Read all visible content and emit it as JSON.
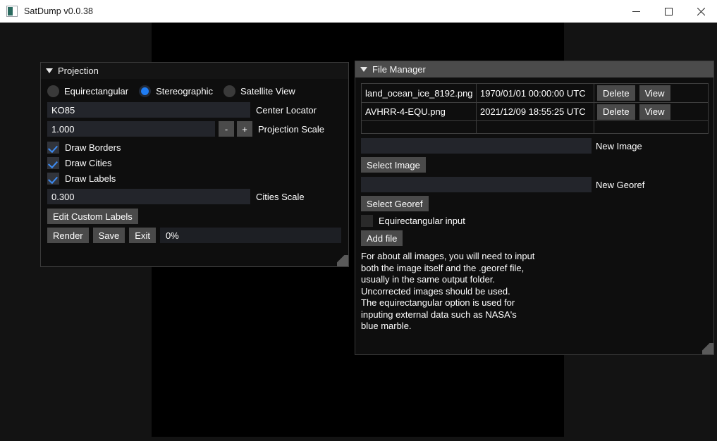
{
  "window": {
    "title": "SatDump v0.0.38",
    "icon": "app-icon",
    "controls": {
      "minimize": "minimize-icon",
      "maximize": "maximize-icon",
      "close": "close-icon"
    }
  },
  "projection_panel": {
    "title": "Projection",
    "collapse_icon": "triangle-down-icon",
    "projection_modes": [
      {
        "label": "Equirectangular",
        "selected": false
      },
      {
        "label": "Stereographic",
        "selected": true
      },
      {
        "label": "Satellite View",
        "selected": false
      }
    ],
    "center_locator": {
      "value": "KO85",
      "label": "Center Locator"
    },
    "projection_scale": {
      "value": "1.000",
      "label": "Projection Scale",
      "decrement": "-",
      "increment": "+"
    },
    "options": [
      {
        "label": "Draw Borders",
        "checked": true
      },
      {
        "label": "Draw Cities",
        "checked": true
      },
      {
        "label": "Draw Labels",
        "checked": true
      }
    ],
    "cities_scale": {
      "value": "0.300",
      "label": "Cities Scale"
    },
    "edit_custom_labels": "Edit Custom Labels",
    "actions": {
      "render": "Render",
      "save": "Save",
      "exit": "Exit"
    },
    "progress": {
      "text": "0%",
      "percent": 0
    }
  },
  "file_manager_panel": {
    "title": "File Manager",
    "collapse_icon": "triangle-down-icon",
    "table": {
      "rows": [
        {
          "name": "land_ocean_ice_8192.png",
          "date": "1970/01/01 00:00:00 UTC",
          "delete_label": "Delete",
          "view_label": "View"
        },
        {
          "name": "AVHRR-4-EQU.png",
          "date": "2021/12/09 18:55:25 UTC",
          "delete_label": "Delete",
          "view_label": "View"
        }
      ]
    },
    "new_image": {
      "value": "",
      "label": "New Image",
      "button": "Select Image"
    },
    "new_georef": {
      "value": "",
      "label": "New Georef",
      "button": "Select Georef"
    },
    "equirectangular_input": {
      "label": "Equirectangular input",
      "checked": false
    },
    "add_file": "Add file",
    "help_text": "For about all images, you will need to input\nboth the image itself and the .georef file,\nusually in the same output folder.\nUncorrected images should be used.\nThe equirectangular option is used for\ninputing external data such as NASA's\nblue marble."
  },
  "colors": {
    "titlebar_bg": "#ffffff",
    "app_bg": "#131313",
    "viewport_bg": "#000000",
    "panel_bg": "#0e0e0e",
    "accent_blue": "#1f7df5",
    "check_blue": "#3d8bf2",
    "button_gray": "#4a4a4a",
    "header_focused": "#4b4b4b"
  }
}
